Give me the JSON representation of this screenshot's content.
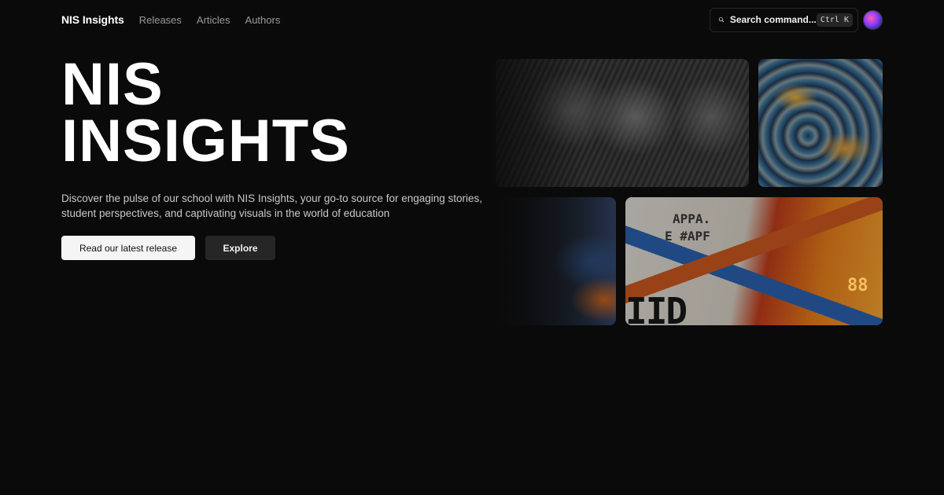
{
  "header": {
    "brand": "NIS Insights",
    "nav": [
      "Releases",
      "Articles",
      "Authors"
    ],
    "search_label": "Search command...",
    "search_shortcut": "Ctrl K"
  },
  "hero": {
    "title_line1": "NIS",
    "title_line2": "INSIGHTS",
    "description": "Discover the pulse of our school with NIS Insights, your go-to source for engaging stories, student perspectives, and captivating visuals in the world of education",
    "primary_button": "Read our latest release",
    "secondary_button": "Explore"
  },
  "gallery": {
    "poster_texts": [
      "APPA.",
      "E #APF",
      "88",
      "IID"
    ]
  },
  "colors": {
    "background": "#0a0a0a",
    "primary_button_bg": "#f5f5f5",
    "secondary_button_bg": "#262626",
    "nav_text": "#9a9a9a"
  },
  "icons": {
    "search": "search-icon",
    "avatar": "avatar"
  }
}
